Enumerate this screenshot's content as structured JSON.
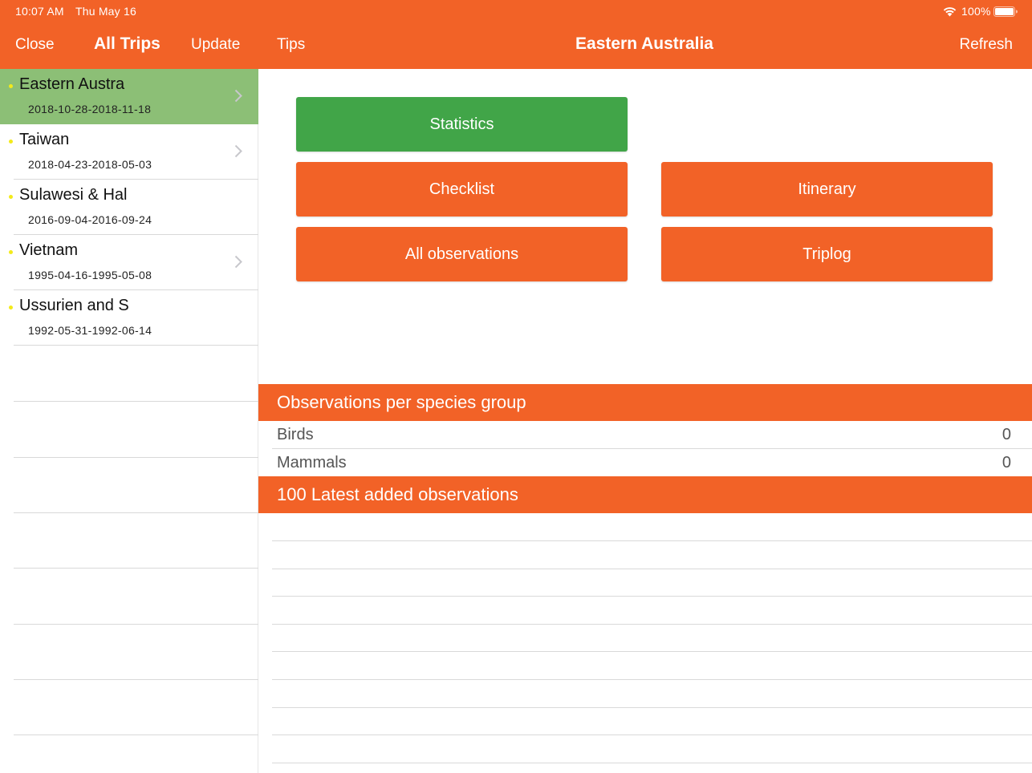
{
  "status_bar": {
    "time": "10:07 AM",
    "date": "Thu May 16",
    "battery": "100%"
  },
  "nav": {
    "close": "Close",
    "all_trips": "All Trips",
    "update": "Update",
    "tips": "Tips",
    "title": "Eastern Australia",
    "refresh": "Refresh"
  },
  "trips": [
    {
      "name": "Eastern Austra",
      "dates": "2018-10-28-2018-11-18",
      "selected": true,
      "has_chevron": true
    },
    {
      "name": "Taiwan",
      "dates": "2018-04-23-2018-05-03",
      "selected": false,
      "has_chevron": true
    },
    {
      "name": "Sulawesi & Hal",
      "dates": "2016-09-04-2016-09-24",
      "selected": false,
      "has_chevron": false
    },
    {
      "name": "Vietnam",
      "dates": "1995-04-16-1995-05-08",
      "selected": false,
      "has_chevron": true
    },
    {
      "name": "Ussurien and S",
      "dates": "1992-05-31-1992-06-14",
      "selected": false,
      "has_chevron": false
    }
  ],
  "buttons": {
    "statistics": "Statistics",
    "checklist": "Checklist",
    "itinerary": "Itinerary",
    "all_observations": "All observations",
    "triplog": "Triplog"
  },
  "species_section": {
    "title": "Observations per species group",
    "rows": [
      {
        "label": "Birds",
        "value": "0"
      },
      {
        "label": "Mammals",
        "value": "0"
      }
    ]
  },
  "latest_section": {
    "title": "100 Latest added observations"
  },
  "colors": {
    "accent": "#f26227",
    "selected_row": "#8cbf76",
    "statistics_button": "#41a548",
    "trip_dot": "#f3ea1a"
  }
}
